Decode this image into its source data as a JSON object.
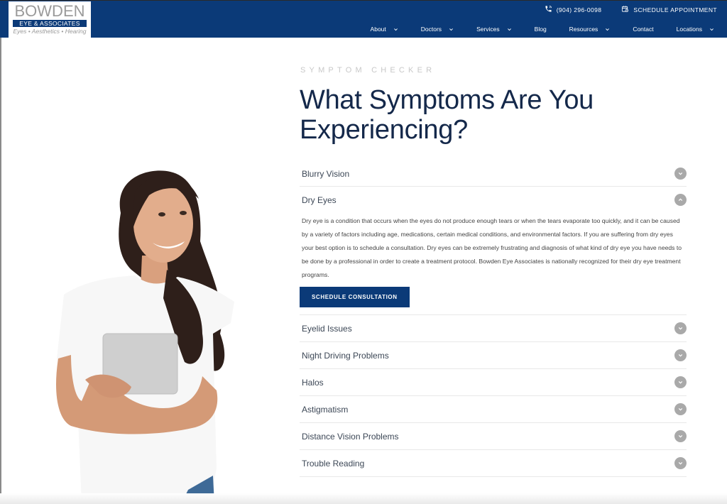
{
  "brand": {
    "name": "BOWDEN",
    "subtitle": "EYE & ASSOCIATES",
    "tagline": "Eyes • Aesthetics • Hearing",
    "primary_color": "#0b3a78"
  },
  "topbar": {
    "phone": "(904) 296-0098",
    "phone_icon": "phone-icon",
    "schedule": "SCHEDULE APPOINTMENT",
    "schedule_icon": "calendar-icon"
  },
  "nav": {
    "items": [
      {
        "label": "About",
        "has_dropdown": true
      },
      {
        "label": "Doctors",
        "has_dropdown": true
      },
      {
        "label": "Services",
        "has_dropdown": true
      },
      {
        "label": "Blog",
        "has_dropdown": false
      },
      {
        "label": "Resources",
        "has_dropdown": true
      },
      {
        "label": "Contact",
        "has_dropdown": false
      },
      {
        "label": "Locations",
        "has_dropdown": true
      }
    ]
  },
  "hero": {
    "image_alt": "Smiling woman holding a tablet"
  },
  "section": {
    "eyebrow": "SYMPTOM CHECKER",
    "title": "What Symptoms Are You Experiencing?"
  },
  "accordion": {
    "items": [
      {
        "title": "Blurry Vision",
        "open": false
      },
      {
        "title": "Dry Eyes",
        "open": true,
        "body": "Dry eye is a condition that occurs when the eyes do not produce enough tears or when the tears evaporate too quickly, and it can be caused by a variety of factors including age, medications, certain medical conditions, and environmental factors. If you are suffering from dry eyes your best option is to schedule a consultation. Dry eyes can be extremely frustrating and diagnosis of what kind of dry eye you have needs to be done by a professional in order to create a treatment protocol. Bowden Eye Associates is nationally recognized for their dry eye treatment programs.",
        "cta": "SCHEDULE CONSULTATION"
      },
      {
        "title": "Eyelid Issues",
        "open": false
      },
      {
        "title": "Night Driving Problems",
        "open": false
      },
      {
        "title": "Halos",
        "open": false
      },
      {
        "title": "Astigmatism",
        "open": false
      },
      {
        "title": "Distance Vision Problems",
        "open": false
      },
      {
        "title": "Trouble Reading",
        "open": false
      }
    ]
  }
}
